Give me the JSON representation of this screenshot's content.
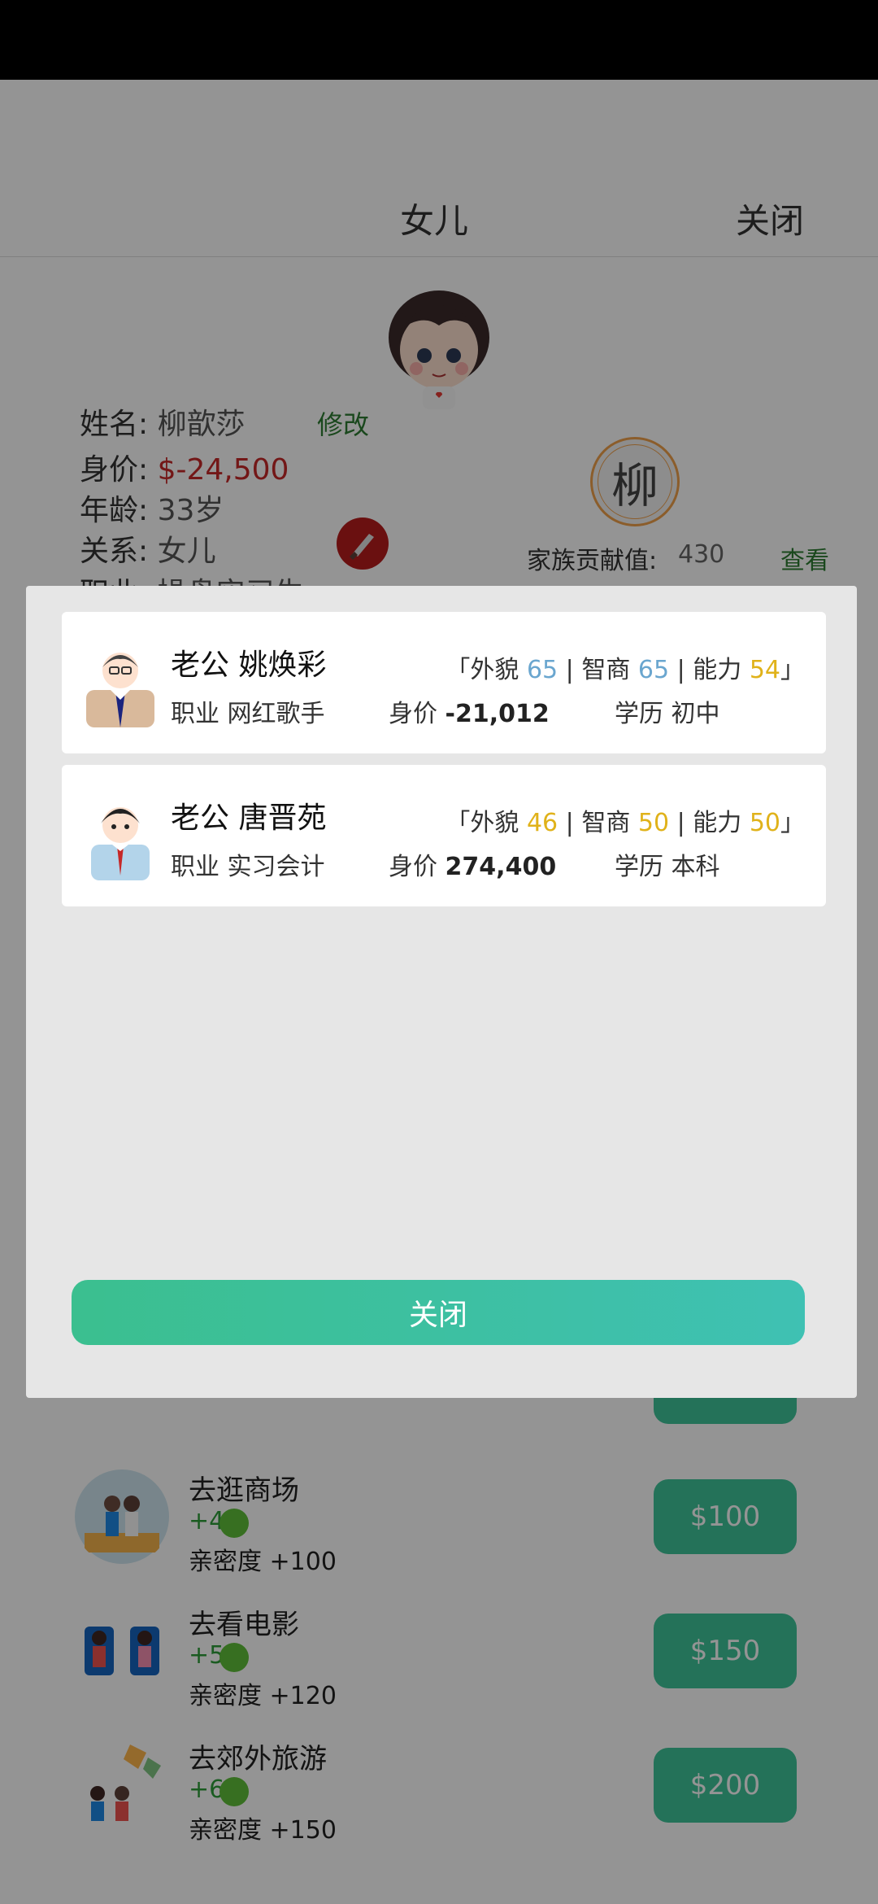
{
  "header": {
    "title": "女儿",
    "close_label": "关闭"
  },
  "profile": {
    "name_label": "姓名:",
    "name_value": "柳歆莎",
    "edit_label": "修改",
    "worth_label": "身价:",
    "worth_value": "$-24,500",
    "age_label": "年龄:",
    "age_value": "33岁",
    "relation_label": "关系:",
    "relation_value": "女儿",
    "job_label": "职业:",
    "job_value": "操盘实习生",
    "seal_char": "柳",
    "contribution_label": "家族贡献值:",
    "contribution_value": "430",
    "view_label": "查看"
  },
  "activities": [
    {
      "name": "",
      "plus": "",
      "intimacy": "",
      "price": ""
    },
    {
      "name": "去逛商场",
      "plus": "+4",
      "intimacy": "亲密度 +100",
      "price": "$100"
    },
    {
      "name": "去看电影",
      "plus": "+5",
      "intimacy": "亲密度 +120",
      "price": "$150"
    },
    {
      "name": "去郊外旅游",
      "plus": "+6",
      "intimacy": "亲密度 +150",
      "price": "$200"
    }
  ],
  "modal": {
    "candidates": [
      {
        "title": "老公 姚焕彩",
        "looks_label": "「外貌",
        "looks": "65",
        "iq_label": "| 智商",
        "iq": "65",
        "ability_label": "| 能力",
        "ability": "54",
        "end": "」",
        "job_label": "职业",
        "job": "网红歌手",
        "worth_label": "身价",
        "worth": "-21,012",
        "edu_label": "学历",
        "edu": "初中"
      },
      {
        "title": "老公 唐晋苑",
        "looks_label": "「外貌",
        "looks": "46",
        "iq_label": "| 智商",
        "iq": "50",
        "ability_label": "| 能力",
        "ability": "50",
        "end": "」",
        "job_label": "职业",
        "job": "实习会计",
        "worth_label": "身价",
        "worth": "274,400",
        "edu_label": "学历",
        "edu": "本科"
      }
    ],
    "close_label": "关闭"
  },
  "colors": {
    "accent_green": "#3fc59a",
    "link_green": "#2e7d32",
    "negative_red": "#c62828",
    "stat_blue": "#6aa6cf",
    "stat_yellow": "#e0b21a"
  }
}
